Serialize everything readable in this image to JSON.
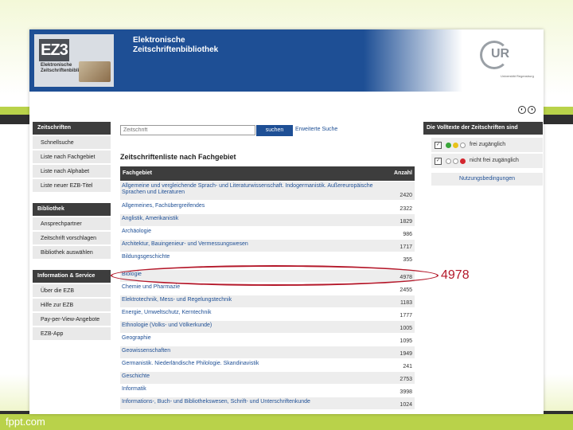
{
  "header": {
    "logo_text": "EZ3",
    "logo_sub": "Elektronische Zeitschriftenbibliothek",
    "title_line1": "Elektronische",
    "title_line2": "Zeitschriftenbibliothek",
    "brand_logo": "UR",
    "brand_sub": "Universität Regensburg"
  },
  "nav": {
    "sections": [
      {
        "title": "Zeitschriften",
        "items": [
          "Schnellsuche",
          "Liste nach Fachgebiet",
          "Liste nach Alphabet",
          "Liste neuer EZB-Titel"
        ]
      },
      {
        "title": "Bibliothek",
        "items": [
          "Ansprechpartner",
          "Zeitschrift vorschlagen",
          "Bibliothek auswählen"
        ]
      },
      {
        "title": "Information & Service",
        "items": [
          "Über die EZB",
          "Hilfe zur EZB",
          "Pay-per-View-Angebote",
          "EZB-App"
        ]
      }
    ]
  },
  "search": {
    "placeholder": "Zeitschrift",
    "button": "suchen",
    "advanced": "Erweiterte Suche"
  },
  "list": {
    "title": "Zeitschriftenliste nach Fachgebiet",
    "col_subject": "Fachgebiet",
    "col_count": "Anzahl",
    "rows": [
      {
        "name": "Allgemeine und vergleichende Sprach- und Literaturwissenschaft. Indogermanistik. Außereuropäische Sprachen und Literaturen",
        "count": "2420"
      },
      {
        "name": "Allgemeines, Fachübergreifendes",
        "count": "2322"
      },
      {
        "name": "Anglistik, Amerikanistik",
        "count": "1829"
      },
      {
        "name": "Archäologie",
        "count": "986"
      },
      {
        "name": "Architektur, Bauingenieur- und Vermessungswesen",
        "count": "1717"
      },
      {
        "name": "Bildungsgeschichte",
        "count": "355"
      },
      {
        "name": "Biologie",
        "count": "4978"
      },
      {
        "name": "Chemie und Pharmazie",
        "count": "2455"
      },
      {
        "name": "Elektrotechnik, Mess- und Regelungstechnik",
        "count": "1183"
      },
      {
        "name": "Energie, Umweltschutz, Kerntechnik",
        "count": "1777"
      },
      {
        "name": "Ethnologie (Volks- und Völkerkunde)",
        "count": "1005"
      },
      {
        "name": "Geographie",
        "count": "1095"
      },
      {
        "name": "Geowissenschaften",
        "count": "1949"
      },
      {
        "name": "Germanistik. Niederländische Philologie. Skandinavistik",
        "count": "241"
      },
      {
        "name": "Geschichte",
        "count": "2753"
      },
      {
        "name": "Informatik",
        "count": "3998"
      },
      {
        "name": "Informations-, Buch- und Bibliothekswesen, Schrift- und Unterschriftenkunde",
        "count": "1024"
      }
    ]
  },
  "right_panel": {
    "title": "Die Volltexte der Zeitschriften sind",
    "options": [
      "frei zugänglich",
      "nicht frei zugänglich"
    ],
    "terms": "Nutzungsbedingungen"
  },
  "annotation": {
    "value": "4978"
  },
  "footer": {
    "text": "fppt.com"
  },
  "colors": {
    "ezb_blue": "#1e4f95",
    "nav_dark": "#3d3d3d",
    "accent_green": "#b9d24a",
    "highlight_red": "#b4182a"
  }
}
